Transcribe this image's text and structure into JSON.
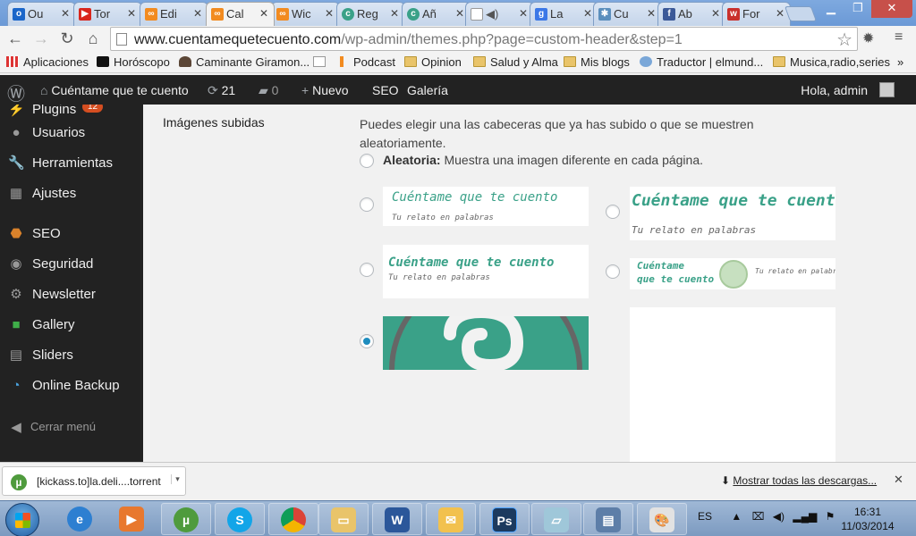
{
  "browser": {
    "tabs": [
      {
        "label": "Ou",
        "icon": "outlook-icon",
        "color": "#1b66c9"
      },
      {
        "label": "Tor",
        "icon": "youtube-icon",
        "color": "#d9261c"
      },
      {
        "label": "Edi",
        "icon": "blogger-icon",
        "color": "#f28b20"
      },
      {
        "label": "Cal",
        "icon": "blogger-icon",
        "color": "#f28b20"
      },
      {
        "label": "Wic",
        "icon": "blogger-icon",
        "color": "#f28b20"
      },
      {
        "label": "Reg",
        "icon": "site-icon",
        "color": "#3aa188"
      },
      {
        "label": "Añ",
        "icon": "site-icon",
        "color": "#3aa188"
      },
      {
        "label": "",
        "icon": "audio-icon",
        "color": "#999999"
      },
      {
        "label": "La",
        "icon": "google-icon",
        "color": "#3b78e7"
      },
      {
        "label": "Cu",
        "icon": "wp-icon",
        "color": "#5b8fbd"
      },
      {
        "label": "Ab",
        "icon": "facebook-icon",
        "color": "#3b5998"
      },
      {
        "label": "For",
        "icon": "wunderground-icon",
        "color": "#c9302c"
      }
    ],
    "active_tab_index": 3,
    "url_domain": "www.cuentamequetecuento.com",
    "url_path": "/wp-admin/themes.php?page=custom-header&step=1",
    "bookmarks": [
      {
        "label": "Aplicaciones",
        "icon": "apps-icon"
      },
      {
        "label": "Horóscopo",
        "icon": "aol-icon"
      },
      {
        "label": "Caminante Giramon...",
        "icon": "person-icon"
      },
      {
        "label": "",
        "icon": "page-icon"
      },
      {
        "label": "Podcast",
        "icon": "podcast-icon"
      },
      {
        "label": "Opinion",
        "icon": "folder-icon"
      },
      {
        "label": "Salud y Alma",
        "icon": "folder-icon"
      },
      {
        "label": "Mis blogs",
        "icon": "folder-icon"
      },
      {
        "label": "Traductor | elmund...",
        "icon": "globe-icon"
      },
      {
        "label": "Musica,radio,series",
        "icon": "folder-icon"
      }
    ],
    "bookmarks_more": "»"
  },
  "adminbar": {
    "site_name": "Cuéntame que te cuento",
    "updates": "21",
    "comments": "0",
    "new_label": "Nuevo",
    "seo_label": "SEO",
    "gallery_label": "Galería",
    "greeting": "Hola, admin"
  },
  "sidebar": {
    "items": [
      {
        "label": "Plugins",
        "icon": "plugin-icon",
        "badge": "12"
      },
      {
        "label": "Usuarios",
        "icon": "users-icon"
      },
      {
        "label": "Herramientas",
        "icon": "wrench-icon"
      },
      {
        "label": "Ajustes",
        "icon": "settings-icon"
      },
      {
        "label": "SEO",
        "icon": "seo-icon"
      },
      {
        "label": "Seguridad",
        "icon": "security-icon"
      },
      {
        "label": "Newsletter",
        "icon": "gear-icon"
      },
      {
        "label": "Gallery",
        "icon": "gallery-icon"
      },
      {
        "label": "Sliders",
        "icon": "sliders-icon"
      },
      {
        "label": "Online Backup",
        "icon": "backup-icon"
      }
    ],
    "collapse_label": "Cerrar menú"
  },
  "main": {
    "section_label": "Imágenes subidas",
    "description": "Puedes elegir una las cabeceras que ya has subido o que se muestren aleatoriamente.",
    "random_bold": "Aleatoria:",
    "random_text": "Muestra una imagen diferente en cada página.",
    "headers": [
      {
        "title": "Cuéntame que te cuento",
        "subtitle": "Tu relato en palabras"
      },
      {
        "title": "Cuéntame que te cuento",
        "subtitle": "Tu relato en palabras"
      },
      {
        "title": "Cuéntame que te cuento",
        "subtitle": "Tu relato en palabras"
      },
      {
        "title_line1": "Cuéntame",
        "title_line2": "que te cuento",
        "subtitle": "Tu relato en palabras"
      },
      {
        "type": "logo-image"
      }
    ],
    "selected_index": 4
  },
  "downloads": {
    "item": "[kickass.to]la.deli....torrent",
    "show_all": "Mostrar todas las descargas..."
  },
  "taskbar": {
    "language": "ES",
    "time": "16:31",
    "date": "11/03/2014",
    "apps": [
      "ie-icon",
      "media-player-icon",
      "utorrent-icon",
      "skype-icon",
      "chrome-icon",
      "explorer-icon",
      "word-icon",
      "outlook-icon",
      "photoshop-icon",
      "notepad-icon",
      "presentation-icon",
      "paint-icon"
    ]
  },
  "colors": {
    "wp_dark": "#222222",
    "accent_teal": "#3aa188",
    "radio_blue": "#1e8cbe"
  }
}
